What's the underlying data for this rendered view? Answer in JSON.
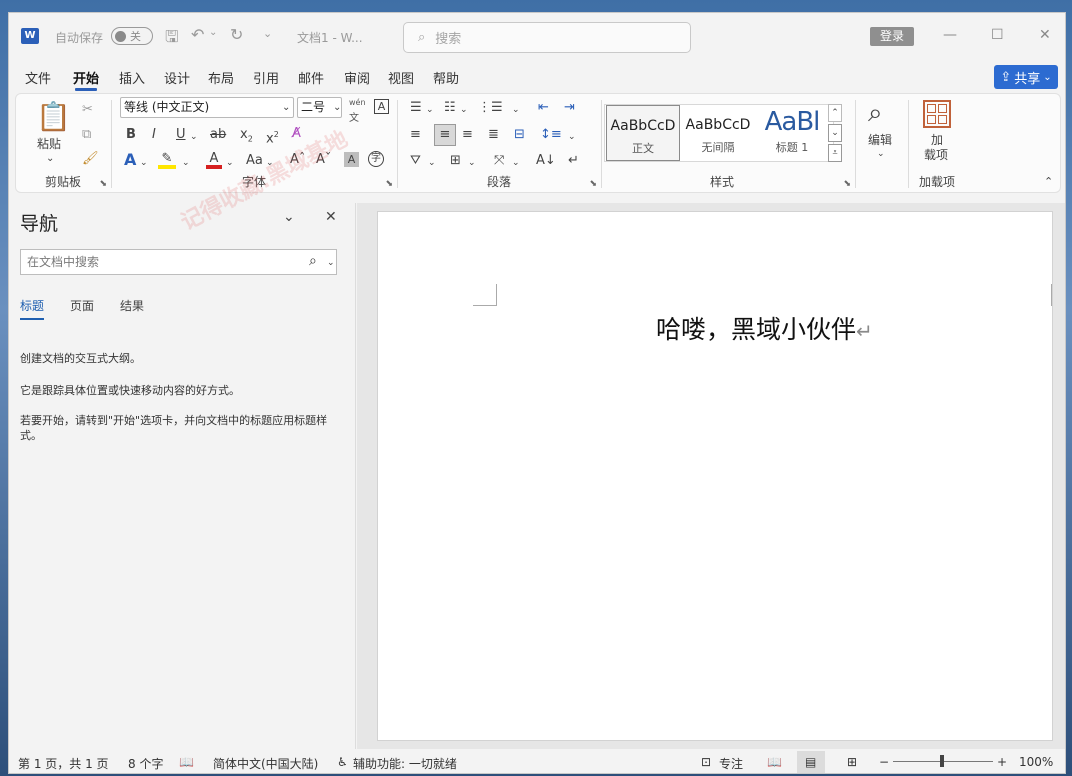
{
  "titlebar": {
    "autosave_label": "自动保存",
    "autosave_state": "关",
    "doc_title": "文档1 - W...",
    "search_placeholder": "搜索",
    "login_label": "登录"
  },
  "menu": {
    "items": [
      "文件",
      "开始",
      "插入",
      "设计",
      "布局",
      "引用",
      "邮件",
      "审阅",
      "视图",
      "帮助"
    ],
    "active": "开始",
    "share_label": "共享"
  },
  "ribbon": {
    "clipboard": {
      "paste_label": "粘贴",
      "group_label": "剪贴板"
    },
    "font": {
      "font_name": "等线 (中文正文)",
      "font_size": "二号",
      "group_label": "字体",
      "wen_label": "wén",
      "wen_char": "文"
    },
    "paragraph": {
      "group_label": "段落"
    },
    "styles": {
      "group_label": "样式",
      "items": [
        {
          "preview": "AaBbCcD",
          "name": "正文"
        },
        {
          "preview": "AaBbCcD",
          "name": "无间隔"
        },
        {
          "preview": "AaBl",
          "name": "标题 1"
        }
      ]
    },
    "editing": {
      "label": "编辑"
    },
    "addins": {
      "label_line1": "加",
      "label_line2": "载项",
      "group_label": "加载项"
    }
  },
  "nav": {
    "title": "导航",
    "search_placeholder": "在文档中搜索",
    "tabs": [
      "标题",
      "页面",
      "结果"
    ],
    "active_tab": "标题",
    "text1": "创建文档的交互式大纲。",
    "text2": "它是跟踪具体位置或快速移动内容的好方式。",
    "text3": "若要开始，请转到\"开始\"选项卡，并向文档中的标题应用标题样式。"
  },
  "document": {
    "text": "哈喽，黑域小伙伴",
    "paragraph_mark": "↵"
  },
  "status": {
    "page": "第 1 页，共 1 页",
    "words": "8 个字",
    "language": "简体中文(中国大陆)",
    "accessibility": "辅助功能: 一切就绪",
    "focus": "专注",
    "zoom": "100%"
  },
  "watermark": "记得收藏:黑域基地",
  "colors": {
    "accent": "#2b5fb8",
    "share_bg": "#2c6bd1",
    "highlight": "#ffe600",
    "font_color": "#d62020"
  }
}
